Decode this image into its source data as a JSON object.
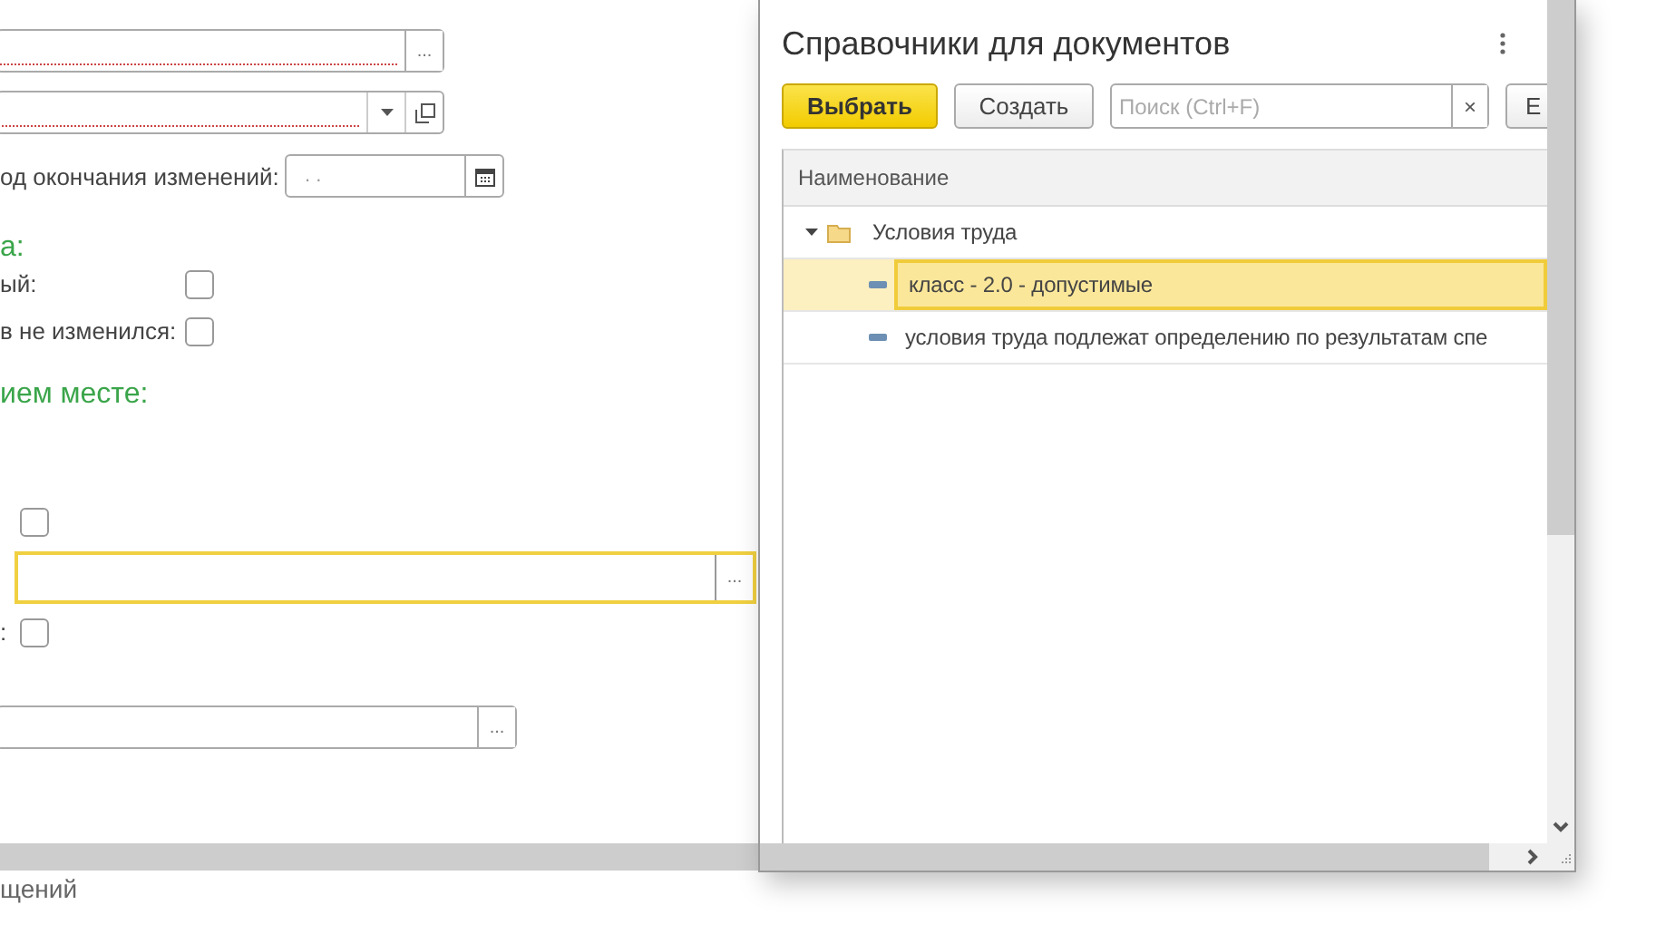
{
  "form": {
    "rows": [
      {
        "kind": "lookup",
        "required": true,
        "focused": false,
        "button": "..."
      },
      {
        "kind": "dropdown",
        "required": true,
        "focused": false
      },
      {
        "kind": "date",
        "label": "од окончания изменений:",
        "value": ". ."
      }
    ],
    "sections": [
      {
        "heading": "а:",
        "rows": [
          {
            "kind": "checkbox",
            "label": "ый:",
            "checked": false
          },
          {
            "kind": "checkbox",
            "label": "в не изменился:",
            "checked": false
          }
        ]
      },
      {
        "heading": "ием месте:",
        "rows": [
          {
            "kind": "checkbox",
            "checked": false
          },
          {
            "kind": "lookup",
            "required": false,
            "focused": true,
            "button": "..."
          },
          {
            "kind": "checkbox",
            "label": ":",
            "checked": false
          },
          {
            "kind": "lookup",
            "required": false,
            "focused": false,
            "button": "..."
          }
        ]
      }
    ],
    "footer": "щений"
  },
  "dialog": {
    "title": "Справочники для документов",
    "toolbar": [
      {
        "kind": "primary",
        "label": "Выбрать"
      },
      {
        "kind": "button",
        "label": "Создать"
      },
      {
        "kind": "search",
        "placeholder": "Поиск (Ctrl+F)",
        "clear": "×"
      },
      {
        "kind": "button",
        "label": "Е"
      }
    ],
    "table": {
      "columns": [
        "Наименование"
      ],
      "tree": [
        {
          "label": "Условия труда",
          "expanded": true,
          "selected": false,
          "children": [
            {
              "label": "класс - 2.0 - допустимые",
              "selected": true
            },
            {
              "label": "условия труда подлежат определению по результатам спе",
              "selected": false
            }
          ]
        }
      ]
    }
  }
}
